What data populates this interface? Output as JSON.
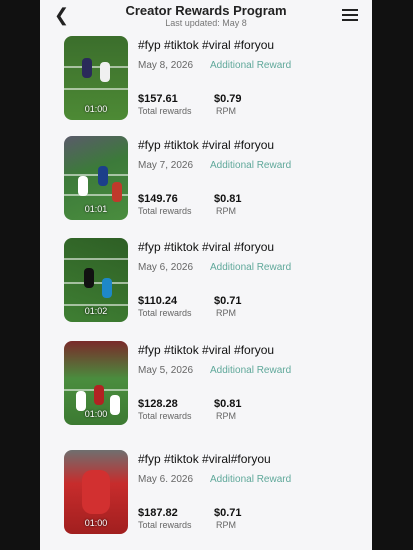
{
  "header": {
    "title": "Creator Rewards Program",
    "subtitle": "Last updated: May 8"
  },
  "icons": {
    "back": "chevron-left-icon",
    "menu": "hamburger-menu-icon"
  },
  "colors": {
    "accent": "#5fa89a"
  },
  "labels": {
    "total_rewards": "Total rewards",
    "rpm": "RPM",
    "additional_reward": "Additional Reward"
  },
  "items": [
    {
      "tags": "#fyp #tiktok #viral #foryou",
      "date": "May 8, 2026",
      "rewards": "$157.61",
      "rpm": "$0.79",
      "duration": "01:00",
      "overlay": ""
    },
    {
      "tags": "#fyp #tiktok #viral #foryou",
      "date": "May 7, 2026",
      "rewards": "$149.76",
      "rpm": "$0.81",
      "duration": "01:01",
      "overlay": ""
    },
    {
      "tags": "#fyp #tiktok #viral #foryou",
      "date": "May 6, 2026",
      "rewards": "$110.24",
      "rpm": "$0.71",
      "duration": "01:02",
      "overlay": ""
    },
    {
      "tags": "#fyp #tiktok #viral #foryou",
      "date": "May 5, 2026",
      "rewards": "$128.28",
      "rpm": "$0.81",
      "duration": "01:00",
      "overlay": ""
    },
    {
      "tags": "#fyp #tiktok #viral#foryou",
      "date": "May 6. 2026",
      "rewards": "$187.82",
      "rpm": "$0.71",
      "duration": "01:00",
      "overlay": ""
    }
  ]
}
